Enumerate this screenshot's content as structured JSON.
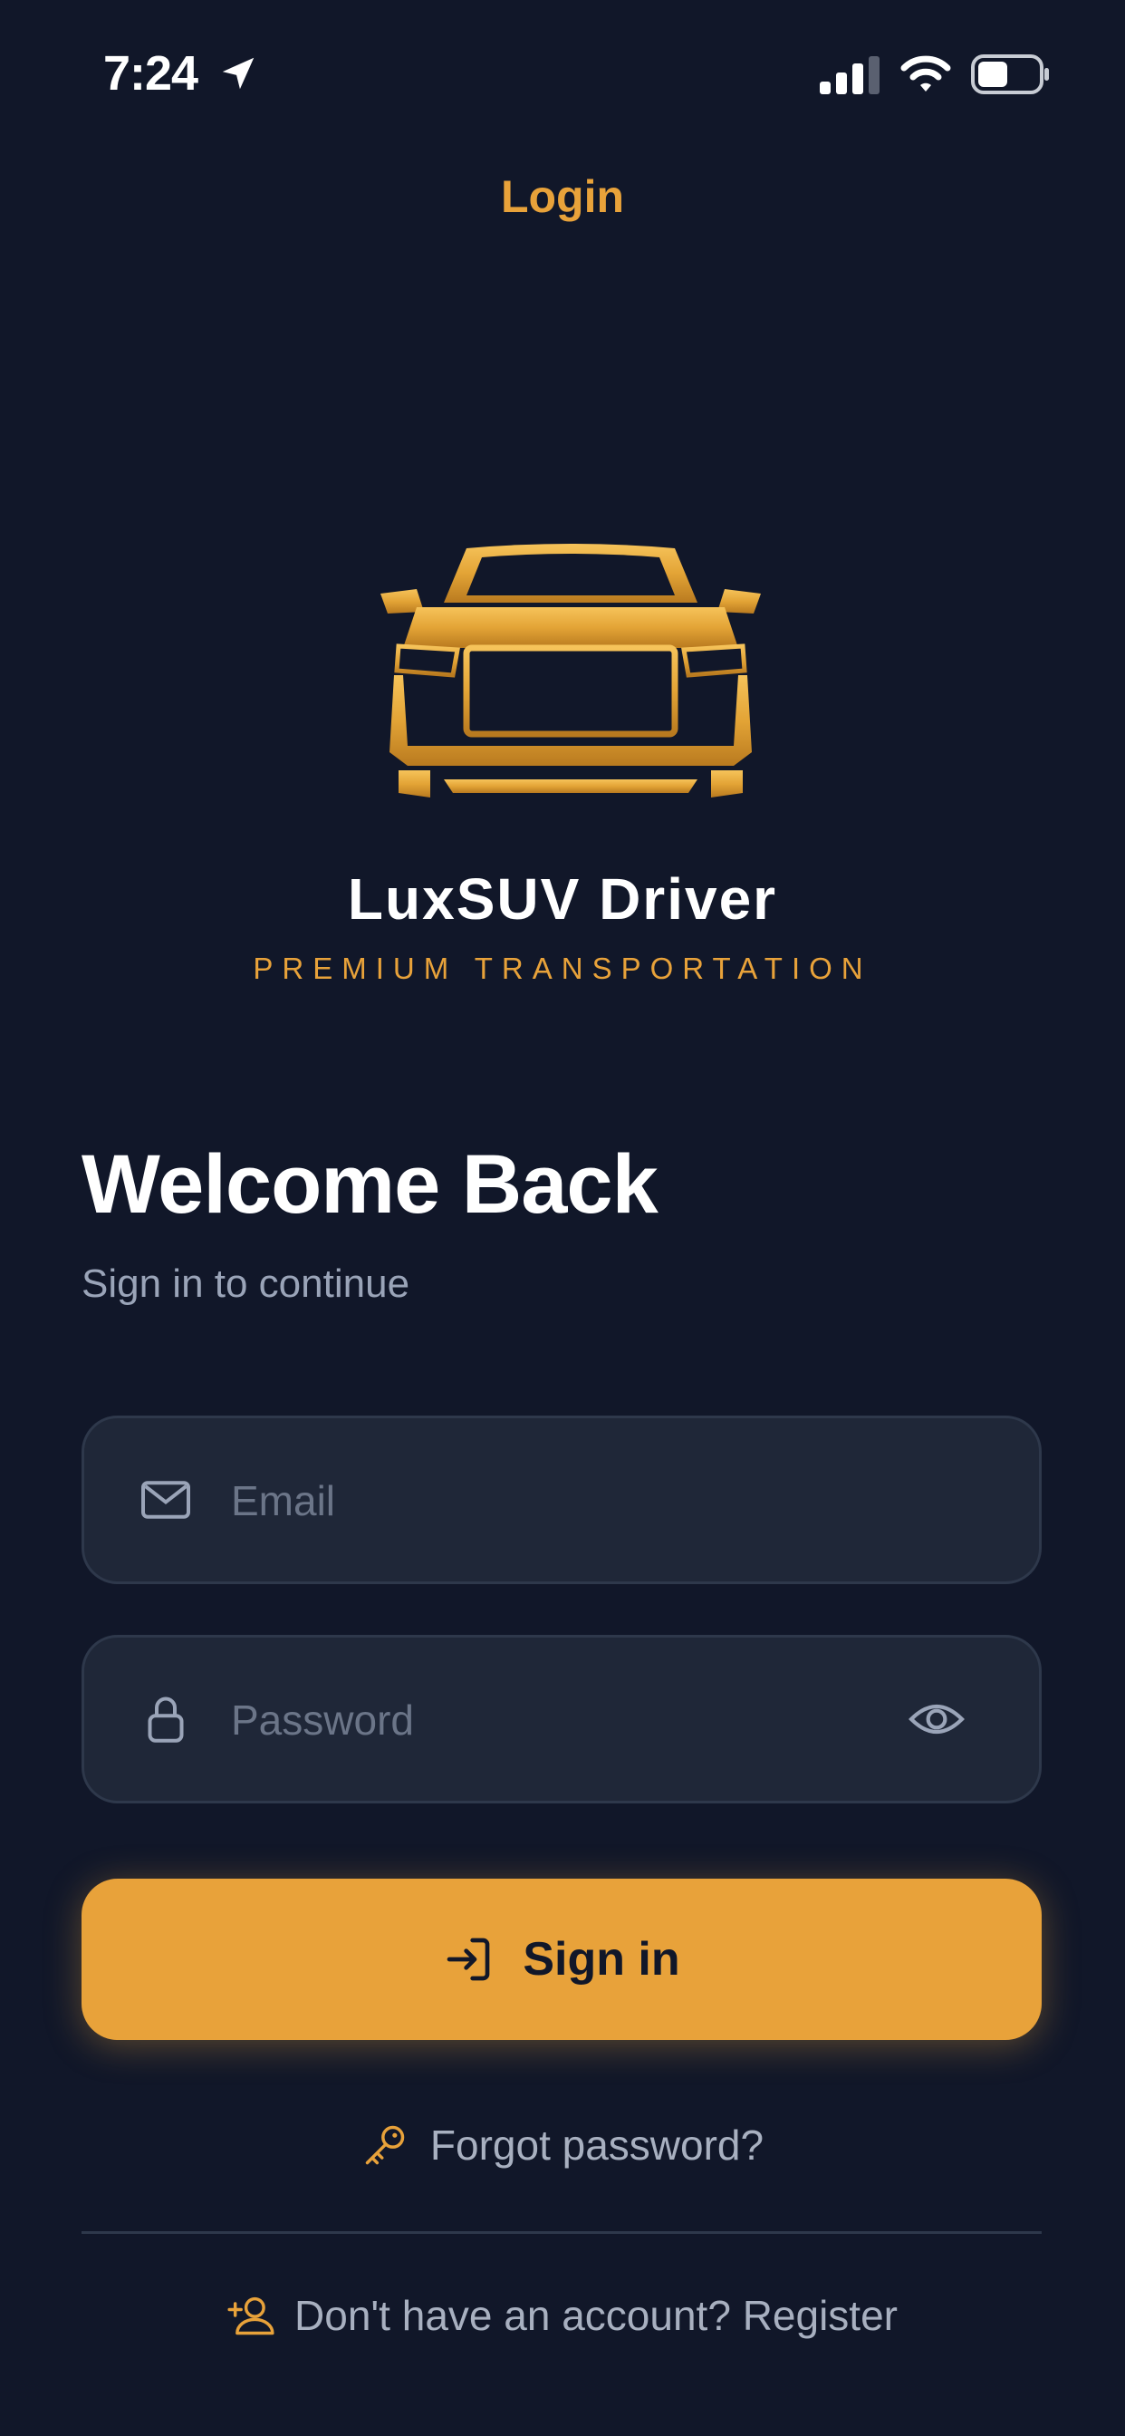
{
  "status_bar": {
    "time": "7:24"
  },
  "header": {
    "title": "Login"
  },
  "brand": {
    "name": "LuxSUV Driver",
    "tagline": "PREMIUM TRANSPORTATION"
  },
  "welcome": {
    "title": "Welcome Back",
    "subtitle": "Sign in to continue"
  },
  "form": {
    "email": {
      "placeholder": "Email",
      "value": "",
      "icon": "mail-icon"
    },
    "password": {
      "placeholder": "Password",
      "value": "",
      "icon": "lock-icon",
      "toggle_icon": "eye-icon"
    },
    "submit_label": "Sign in"
  },
  "links": {
    "forgot_label": "Forgot password?",
    "register_label": "Don't have an account? Register"
  },
  "colors": {
    "background": "#111729",
    "accent": "#E8A23A",
    "field": "#1f2738",
    "muted_text": "#9aa4b8"
  }
}
